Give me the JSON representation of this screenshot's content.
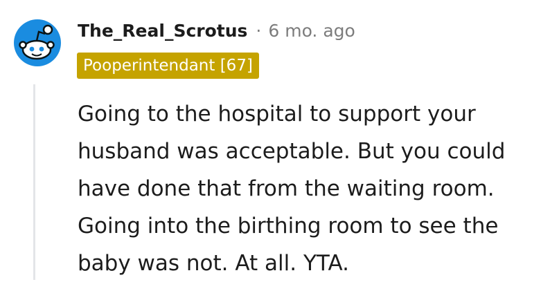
{
  "comment": {
    "username": "The_Real_Scrotus",
    "separator": "·",
    "timestamp": "6 mo. ago",
    "flair": "Pooperintendant [67]",
    "body": "Going to the hospital to support your husband was acceptable. But you could have done that from the waiting room. Going into the birthing room to see the baby was not. At all. YTA."
  },
  "avatar": {
    "icon": "reddit-snoo-icon",
    "background_color": "#1a8ce0"
  },
  "colors": {
    "flair_background": "#c5a300",
    "flair_text": "#ffffff",
    "meta_text": "#7c7c7c",
    "thread_line": "#e3e5e8"
  }
}
